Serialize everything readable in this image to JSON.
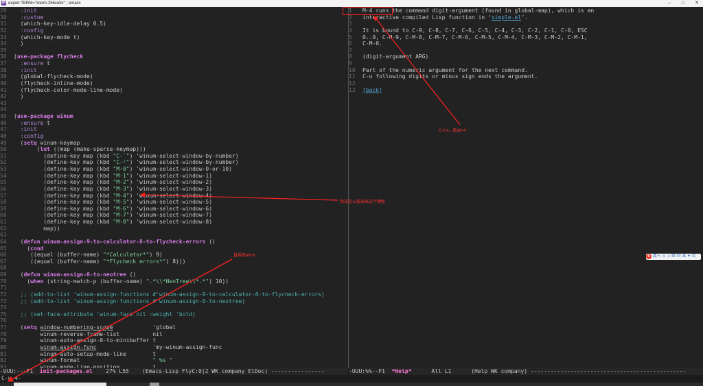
{
  "window": {
    "title": "export TERM=\"xterm-256color\" ; emacs",
    "app_icon": "emacs-icon",
    "controls": [
      "–",
      "□",
      "✕"
    ]
  },
  "left_pane": {
    "lines": [
      {
        "n": "29",
        "segs": [
          {
            "c": "kw2",
            "t": "  :init"
          }
        ]
      },
      {
        "n": "30",
        "segs": [
          {
            "c": "kw2",
            "t": "  :custom"
          }
        ]
      },
      {
        "n": "31",
        "segs": [
          {
            "c": "pl",
            "t": "  (which-key-idle-delay 0.5)"
          }
        ]
      },
      {
        "n": "32",
        "segs": [
          {
            "c": "kw2",
            "t": "  :config"
          }
        ]
      },
      {
        "n": "33",
        "segs": [
          {
            "c": "pl",
            "t": "  (which-key-mode t)"
          }
        ]
      },
      {
        "n": "34",
        "segs": [
          {
            "c": "pl",
            "t": "  )"
          }
        ]
      },
      {
        "n": "35",
        "segs": [
          {
            "c": "pl",
            "t": ""
          }
        ]
      },
      {
        "n": "36",
        "segs": [
          {
            "c": "pl",
            "t": "("
          },
          {
            "c": "kw",
            "t": "use-package"
          },
          {
            "c": "pl",
            "t": " "
          },
          {
            "c": "fn",
            "t": "flycheck"
          }
        ]
      },
      {
        "n": "37",
        "segs": [
          {
            "c": "kw2",
            "t": "  :ensure"
          },
          {
            "c": "pl",
            "t": " t"
          }
        ]
      },
      {
        "n": "38",
        "segs": [
          {
            "c": "kw2",
            "t": "  :init"
          }
        ]
      },
      {
        "n": "39",
        "segs": [
          {
            "c": "pl",
            "t": "  (global-flycheck-mode)"
          }
        ]
      },
      {
        "n": "40",
        "segs": [
          {
            "c": "pl",
            "t": "  (flycheck-inline-mode)"
          }
        ]
      },
      {
        "n": "41",
        "segs": [
          {
            "c": "pl",
            "t": "  (flycheck-color-mode-line-mode)"
          }
        ]
      },
      {
        "n": "42",
        "segs": [
          {
            "c": "pl",
            "t": "  )"
          }
        ]
      },
      {
        "n": "43",
        "segs": [
          {
            "c": "pl",
            "t": ""
          }
        ]
      },
      {
        "n": "44",
        "segs": [
          {
            "c": "pl",
            "t": ""
          }
        ]
      },
      {
        "n": "45",
        "segs": [
          {
            "c": "pl",
            "t": "("
          },
          {
            "c": "kw",
            "t": "use-package"
          },
          {
            "c": "pl",
            "t": " "
          },
          {
            "c": "fn",
            "t": "winum"
          }
        ]
      },
      {
        "n": "46",
        "segs": [
          {
            "c": "kw2",
            "t": "  :ensure"
          },
          {
            "c": "pl",
            "t": " t"
          }
        ]
      },
      {
        "n": "47",
        "segs": [
          {
            "c": "kw2",
            "t": "  :init"
          }
        ]
      },
      {
        "n": "48",
        "segs": [
          {
            "c": "kw2",
            "t": "  :config"
          }
        ]
      },
      {
        "n": "49",
        "segs": [
          {
            "c": "pl",
            "t": "  ("
          },
          {
            "c": "kw",
            "t": "setq"
          },
          {
            "c": "pl",
            "t": " winum-keymap"
          }
        ]
      },
      {
        "n": "50",
        "segs": [
          {
            "c": "pl",
            "t": "       ("
          },
          {
            "c": "kw",
            "t": "let"
          },
          {
            "c": "pl",
            "t": " ((map (make-sparse-keymap)))"
          }
        ]
      },
      {
        "n": "51",
        "segs": [
          {
            "c": "pl",
            "t": "         (define-key map (kbd "
          },
          {
            "c": "str",
            "t": "\"C-`\""
          },
          {
            "c": "pl",
            "t": ") 'winum-select-window-by-number)"
          }
        ]
      },
      {
        "n": "52",
        "segs": [
          {
            "c": "pl",
            "t": "         (define-key map (kbd "
          },
          {
            "c": "str",
            "t": "\"C-²\""
          },
          {
            "c": "pl",
            "t": ") 'winum-select-window-by-number)"
          }
        ]
      },
      {
        "n": "53",
        "segs": [
          {
            "c": "pl",
            "t": "         (define-key map (kbd "
          },
          {
            "c": "str",
            "t": "\"M-0\""
          },
          {
            "c": "pl",
            "t": ") 'winum-select-window-0-or-10)"
          }
        ]
      },
      {
        "n": "54",
        "segs": [
          {
            "c": "pl",
            "t": "         (define-key map (kbd "
          },
          {
            "c": "str",
            "t": "\"M-1\""
          },
          {
            "c": "pl",
            "t": ") 'winum-select-window-1)"
          }
        ]
      },
      {
        "n": "55",
        "segs": [
          {
            "c": "pl",
            "t": "         (define-key map (kbd "
          },
          {
            "c": "str",
            "t": "\"M-2\""
          },
          {
            "c": "pl",
            "t": ") 'winum-select-window-2)"
          }
        ]
      },
      {
        "n": "56",
        "segs": [
          {
            "c": "pl",
            "t": "         (define-key map (kbd "
          },
          {
            "c": "str",
            "t": "\"M-3\""
          },
          {
            "c": "pl",
            "t": ") 'winum-select-window-3)"
          }
        ]
      },
      {
        "n": "57",
        "segs": [
          {
            "c": "pl",
            "t": "         (define-key map (kbd "
          },
          {
            "c": "str",
            "t": "\"M-4\""
          },
          {
            "c": "pl",
            "t": ") 'winum-select-window-4)"
          }
        ]
      },
      {
        "n": "58",
        "segs": [
          {
            "c": "pl",
            "t": "         (define-key map (kbd "
          },
          {
            "c": "str",
            "t": "\"M-5\""
          },
          {
            "c": "pl",
            "t": ") 'winum-select-window-5)"
          }
        ]
      },
      {
        "n": "59",
        "segs": [
          {
            "c": "pl",
            "t": "         (define-key map (kbd "
          },
          {
            "c": "str",
            "t": "\"M-6\""
          },
          {
            "c": "pl",
            "t": ") 'winum-select-window-6)"
          }
        ]
      },
      {
        "n": "60",
        "segs": [
          {
            "c": "pl",
            "t": "         (define-key map (kbd "
          },
          {
            "c": "str",
            "t": "\"M-7\""
          },
          {
            "c": "pl",
            "t": ") 'winum-select-window-7)"
          }
        ]
      },
      {
        "n": "61",
        "segs": [
          {
            "c": "pl",
            "t": "         (define-key map (kbd "
          },
          {
            "c": "str",
            "t": "\"M-8\""
          },
          {
            "c": "pl",
            "t": ") 'winum-select-window-8)"
          }
        ]
      },
      {
        "n": "62",
        "segs": [
          {
            "c": "pl",
            "t": "         map))"
          }
        ]
      },
      {
        "n": "63",
        "segs": [
          {
            "c": "pl",
            "t": ""
          }
        ]
      },
      {
        "n": "64",
        "segs": [
          {
            "c": "pl",
            "t": "  ("
          },
          {
            "c": "kw",
            "t": "defun"
          },
          {
            "c": "pl",
            "t": " "
          },
          {
            "c": "fn",
            "t": "winum-assign-9-to-calculator-8-to-flycheck-errors"
          },
          {
            "c": "pl",
            "t": " ()"
          }
        ]
      },
      {
        "n": "65",
        "segs": [
          {
            "c": "pl",
            "t": "    ("
          },
          {
            "c": "kw",
            "t": "cond"
          }
        ]
      },
      {
        "n": "66",
        "segs": [
          {
            "c": "pl",
            "t": "     ((equal (buffer-name) "
          },
          {
            "c": "str",
            "t": "\"*Calculator*\""
          },
          {
            "c": "pl",
            "t": ") 9)"
          }
        ]
      },
      {
        "n": "67",
        "segs": [
          {
            "c": "pl",
            "t": "     ((equal (buffer-name) "
          },
          {
            "c": "str",
            "t": "\"*Flycheck errors*\""
          },
          {
            "c": "pl",
            "t": ") 8)))"
          }
        ]
      },
      {
        "n": "68",
        "segs": [
          {
            "c": "pl",
            "t": ""
          }
        ]
      },
      {
        "n": "69",
        "segs": [
          {
            "c": "pl",
            "t": "  ("
          },
          {
            "c": "kw",
            "t": "defun"
          },
          {
            "c": "pl",
            "t": " "
          },
          {
            "c": "fn",
            "t": "winum-assign-0-to-neotree"
          },
          {
            "c": "pl",
            "t": " ()"
          }
        ]
      },
      {
        "n": "70",
        "segs": [
          {
            "c": "pl",
            "t": "    ("
          },
          {
            "c": "kw",
            "t": "when"
          },
          {
            "c": "pl",
            "t": " (string-match-p (buffer-name) "
          },
          {
            "c": "str",
            "t": "\".*\\\\*NeoTree\\\\*.*\""
          },
          {
            "c": "pl",
            "t": ") 10))"
          }
        ]
      },
      {
        "n": "71",
        "segs": [
          {
            "c": "pl",
            "t": ""
          }
        ]
      },
      {
        "n": "72",
        "segs": [
          {
            "c": "cm",
            "t": "  ;; (add-to-list 'winum-assign-functions #'winum-assign-9-to-calculator-8-to-flycheck-errors)"
          }
        ]
      },
      {
        "n": "73",
        "segs": [
          {
            "c": "cm",
            "t": "  ;; (add-to-list 'winum-assign-functions #'winum-assign-0-to-neotree)"
          }
        ]
      },
      {
        "n": "74",
        "segs": [
          {
            "c": "pl",
            "t": ""
          }
        ]
      },
      {
        "n": "75",
        "segs": [
          {
            "c": "cm",
            "t": "  ;; (set-face-attribute 'winum-face nil :weight 'bold)"
          }
        ]
      },
      {
        "n": "76",
        "segs": [
          {
            "c": "pl",
            "t": ""
          }
        ]
      },
      {
        "n": "77",
        "segs": [
          {
            "c": "pl",
            "t": "  ("
          },
          {
            "c": "kw",
            "t": "setq"
          },
          {
            "c": "pl",
            "t": " "
          },
          {
            "c": "ul",
            "t": "window-numbering-scope"
          },
          {
            "c": "pl",
            "t": "            'global"
          }
        ]
      },
      {
        "n": "78",
        "segs": [
          {
            "c": "pl",
            "t": "        winum-reverse-frame-list          nil"
          }
        ]
      },
      {
        "n": "79",
        "segs": [
          {
            "c": "pl",
            "t": "        winum-auto-assign-0-to-minibuffer t"
          }
        ]
      },
      {
        "n": "80",
        "segs": [
          {
            "c": "pl",
            "t": "        "
          },
          {
            "c": "ul",
            "t": "winum-assign-func"
          },
          {
            "c": "pl",
            "t": "                 'my-winum-assign-func"
          }
        ]
      },
      {
        "n": "81",
        "segs": [
          {
            "c": "pl",
            "t": "        winum-auto-setup-mode-line        t"
          }
        ]
      },
      {
        "n": "82",
        "segs": [
          {
            "c": "pl",
            "t": "        winum-format                      "
          },
          {
            "c": "str",
            "t": "\" %s \""
          }
        ]
      },
      {
        "n": "83",
        "segs": [
          {
            "c": "pl",
            "t": "        winum-mode-line-position          1"
          }
        ]
      }
    ]
  },
  "right_pane": {
    "lines": [
      {
        "n": "1",
        "segs": [
          {
            "c": "pl",
            "t": "M-4 runs the command digit-argument (found in global-map), which is an"
          }
        ]
      },
      {
        "n": "2",
        "segs": [
          {
            "c": "pl",
            "t": "interactive compiled Lisp function in ‘"
          },
          {
            "c": "link",
            "t": "simple.el"
          },
          {
            "c": "pl",
            "t": "’."
          }
        ]
      },
      {
        "n": "3",
        "segs": [
          {
            "c": "pl",
            "t": ""
          }
        ]
      },
      {
        "n": "4",
        "segs": [
          {
            "c": "pl",
            "t": "It is bound to C-9, C-8, C-7, C-6, C-5, C-4, C-3, C-2, C-1, C-0, ESC"
          }
        ]
      },
      {
        "n": "5",
        "segs": [
          {
            "c": "pl",
            "t": "0..9, C-M-9, C-M-8, C-M-7, C-M-6, C-M-5, C-M-4, C-M-3, C-M-2, C-M-1,"
          }
        ]
      },
      {
        "n": "6",
        "segs": [
          {
            "c": "pl",
            "t": "C-M-0."
          }
        ]
      },
      {
        "n": "7",
        "segs": [
          {
            "c": "pl",
            "t": ""
          }
        ]
      },
      {
        "n": "8",
        "segs": [
          {
            "c": "pl",
            "t": "(digit-argument "
          },
          {
            "c": "pl",
            "t": "ARG"
          },
          {
            "c": "pl",
            "t": ")"
          }
        ]
      },
      {
        "n": "9",
        "segs": [
          {
            "c": "pl",
            "t": ""
          }
        ]
      },
      {
        "n": "10",
        "segs": [
          {
            "c": "pl",
            "t": "Part of the numeric argument for the next command."
          }
        ]
      },
      {
        "n": "11",
        "segs": [
          {
            "c": "pl",
            "t": "C-u following digits or minus sign ends the argument."
          }
        ]
      },
      {
        "n": "12",
        "segs": [
          {
            "c": "pl",
            "t": ""
          }
        ]
      },
      {
        "n": "13",
        "segs": [
          {
            "c": "link",
            "t": "[back]"
          }
        ]
      }
    ]
  },
  "modeline_left": {
    "prefix": "-UUU:---F1  ",
    "buffer": "init-packages.el",
    "rest": "    27% L55    (Emacs-Lisp FlyC:0|2 WK company ElDoc) ----------------"
  },
  "modeline_right": {
    "prefix": "-UUU:%%--F1  ",
    "buffer": "*Help*",
    "rest": "      All L1      (Help WK company) -----------------------------------------------"
  },
  "echo_area": "C-u 4-",
  "annotations": {
    "top_right": "C-h k，按alt+4",
    "middle": "我该怎么按出来这个键呢",
    "lower": "直接按alt+4"
  },
  "ime_toolbar": {
    "logo": "S",
    "label": "英 •, ☺ ♫ ▦ ▤ ♨ ✦ ▥"
  },
  "colors": {
    "annotation": "#ff2020",
    "background": "#222222"
  }
}
